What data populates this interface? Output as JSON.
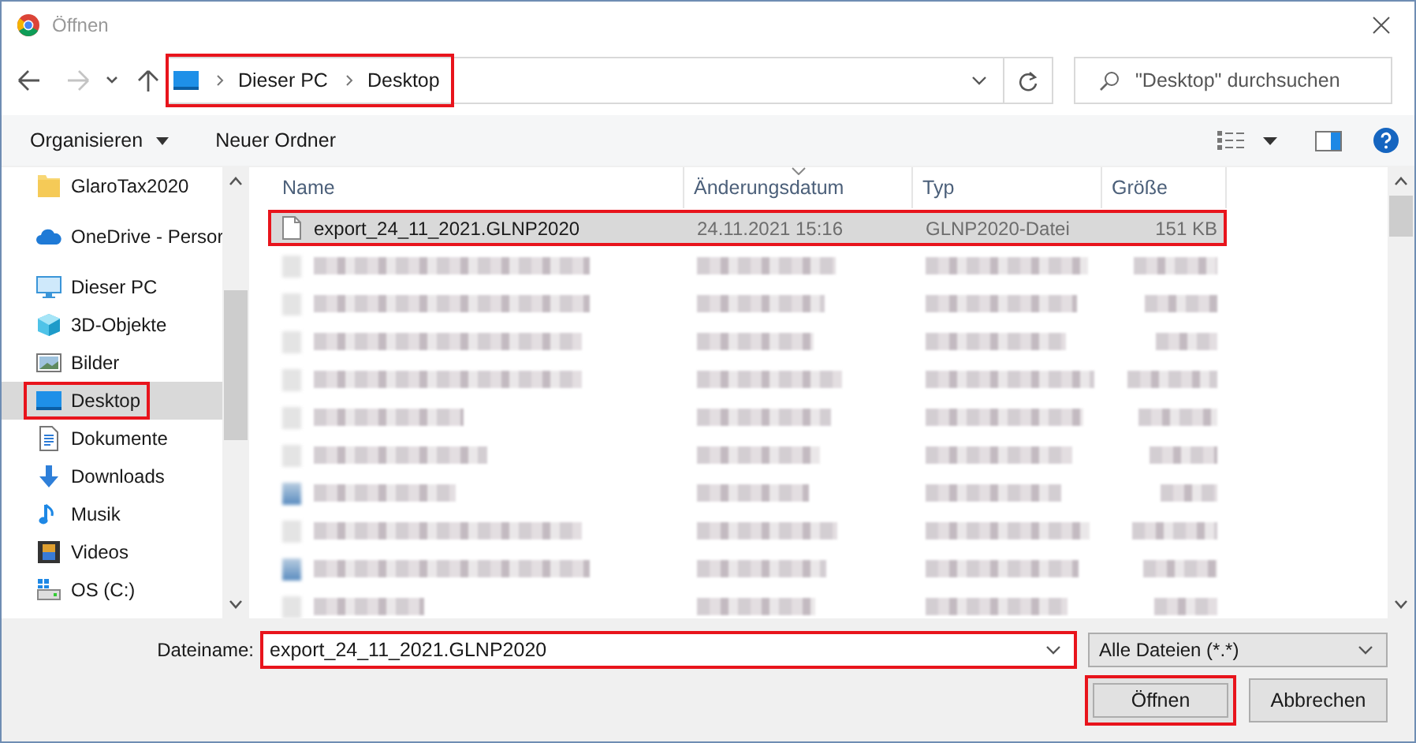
{
  "window": {
    "title": "Öffnen"
  },
  "nav": [
    {
      "kind": "back",
      "disabled": false
    },
    {
      "kind": "forward",
      "disabled": true
    },
    {
      "kind": "recent",
      "disabled": false
    },
    {
      "kind": "up",
      "disabled": false
    }
  ],
  "address": {
    "crumbs": [
      "Dieser PC",
      "Desktop"
    ],
    "highlighted": true
  },
  "search": {
    "placeholder": "\"Desktop\" durchsuchen"
  },
  "toolbar": {
    "buttons": [
      {
        "label": "Organisieren",
        "has_menu": true
      },
      {
        "label": "Neuer Ordner",
        "has_menu": false
      }
    ]
  },
  "sidebar": {
    "items": [
      {
        "label": "GlaroTax2020",
        "selected": false,
        "highlighted": false
      },
      {
        "label": "OneDrive - Persor",
        "selected": false,
        "highlighted": false
      },
      {
        "label": "Dieser PC",
        "selected": false,
        "highlighted": false,
        "children": [
          {
            "label": "3D-Objekte",
            "selected": false,
            "highlighted": false
          },
          {
            "label": "Bilder",
            "selected": false,
            "highlighted": false
          },
          {
            "label": "Desktop",
            "selected": true,
            "highlighted": true
          },
          {
            "label": "Dokumente",
            "selected": false,
            "highlighted": false
          },
          {
            "label": "Downloads",
            "selected": false,
            "highlighted": false
          },
          {
            "label": "Musik",
            "selected": false,
            "highlighted": false
          },
          {
            "label": "Videos",
            "selected": false,
            "highlighted": false
          },
          {
            "label": "OS (C:)",
            "selected": false,
            "highlighted": false
          }
        ]
      }
    ]
  },
  "table": {
    "columns": [
      {
        "label": "Name",
        "sorted": false
      },
      {
        "label": "Änderungsdatum",
        "sorted": true
      },
      {
        "label": "Typ",
        "sorted": false
      },
      {
        "label": "Größe",
        "sorted": false
      }
    ],
    "rows": [
      {
        "kind": "file",
        "cells": [
          "export_24_11_2021.GLNP2020",
          "24.11.2021 15:16",
          "GLNP2020-Datei",
          "151 KB"
        ],
        "selected": true,
        "highlighted": true
      },
      {
        "kind": "blurred",
        "selected": false
      },
      {
        "kind": "blurred",
        "selected": false
      },
      {
        "kind": "blurred",
        "selected": false
      },
      {
        "kind": "blurred",
        "selected": false
      },
      {
        "kind": "blurred",
        "selected": false
      },
      {
        "kind": "blurred",
        "selected": false
      },
      {
        "kind": "blurred",
        "selected": false
      },
      {
        "kind": "blurred",
        "selected": false
      },
      {
        "kind": "blurred",
        "selected": false
      },
      {
        "kind": "blurred",
        "selected": false
      }
    ]
  },
  "footer": {
    "filename_label": "Dateiname:",
    "filename": {
      "value": "export_24_11_2021.GLNP2020",
      "highlighted": true
    },
    "filter": "Alle Dateien (*.*)",
    "buttons": [
      {
        "label": "Öffnen",
        "default": true,
        "highlighted": true
      },
      {
        "label": "Abbrechen",
        "default": false,
        "highlighted": false
      }
    ]
  }
}
